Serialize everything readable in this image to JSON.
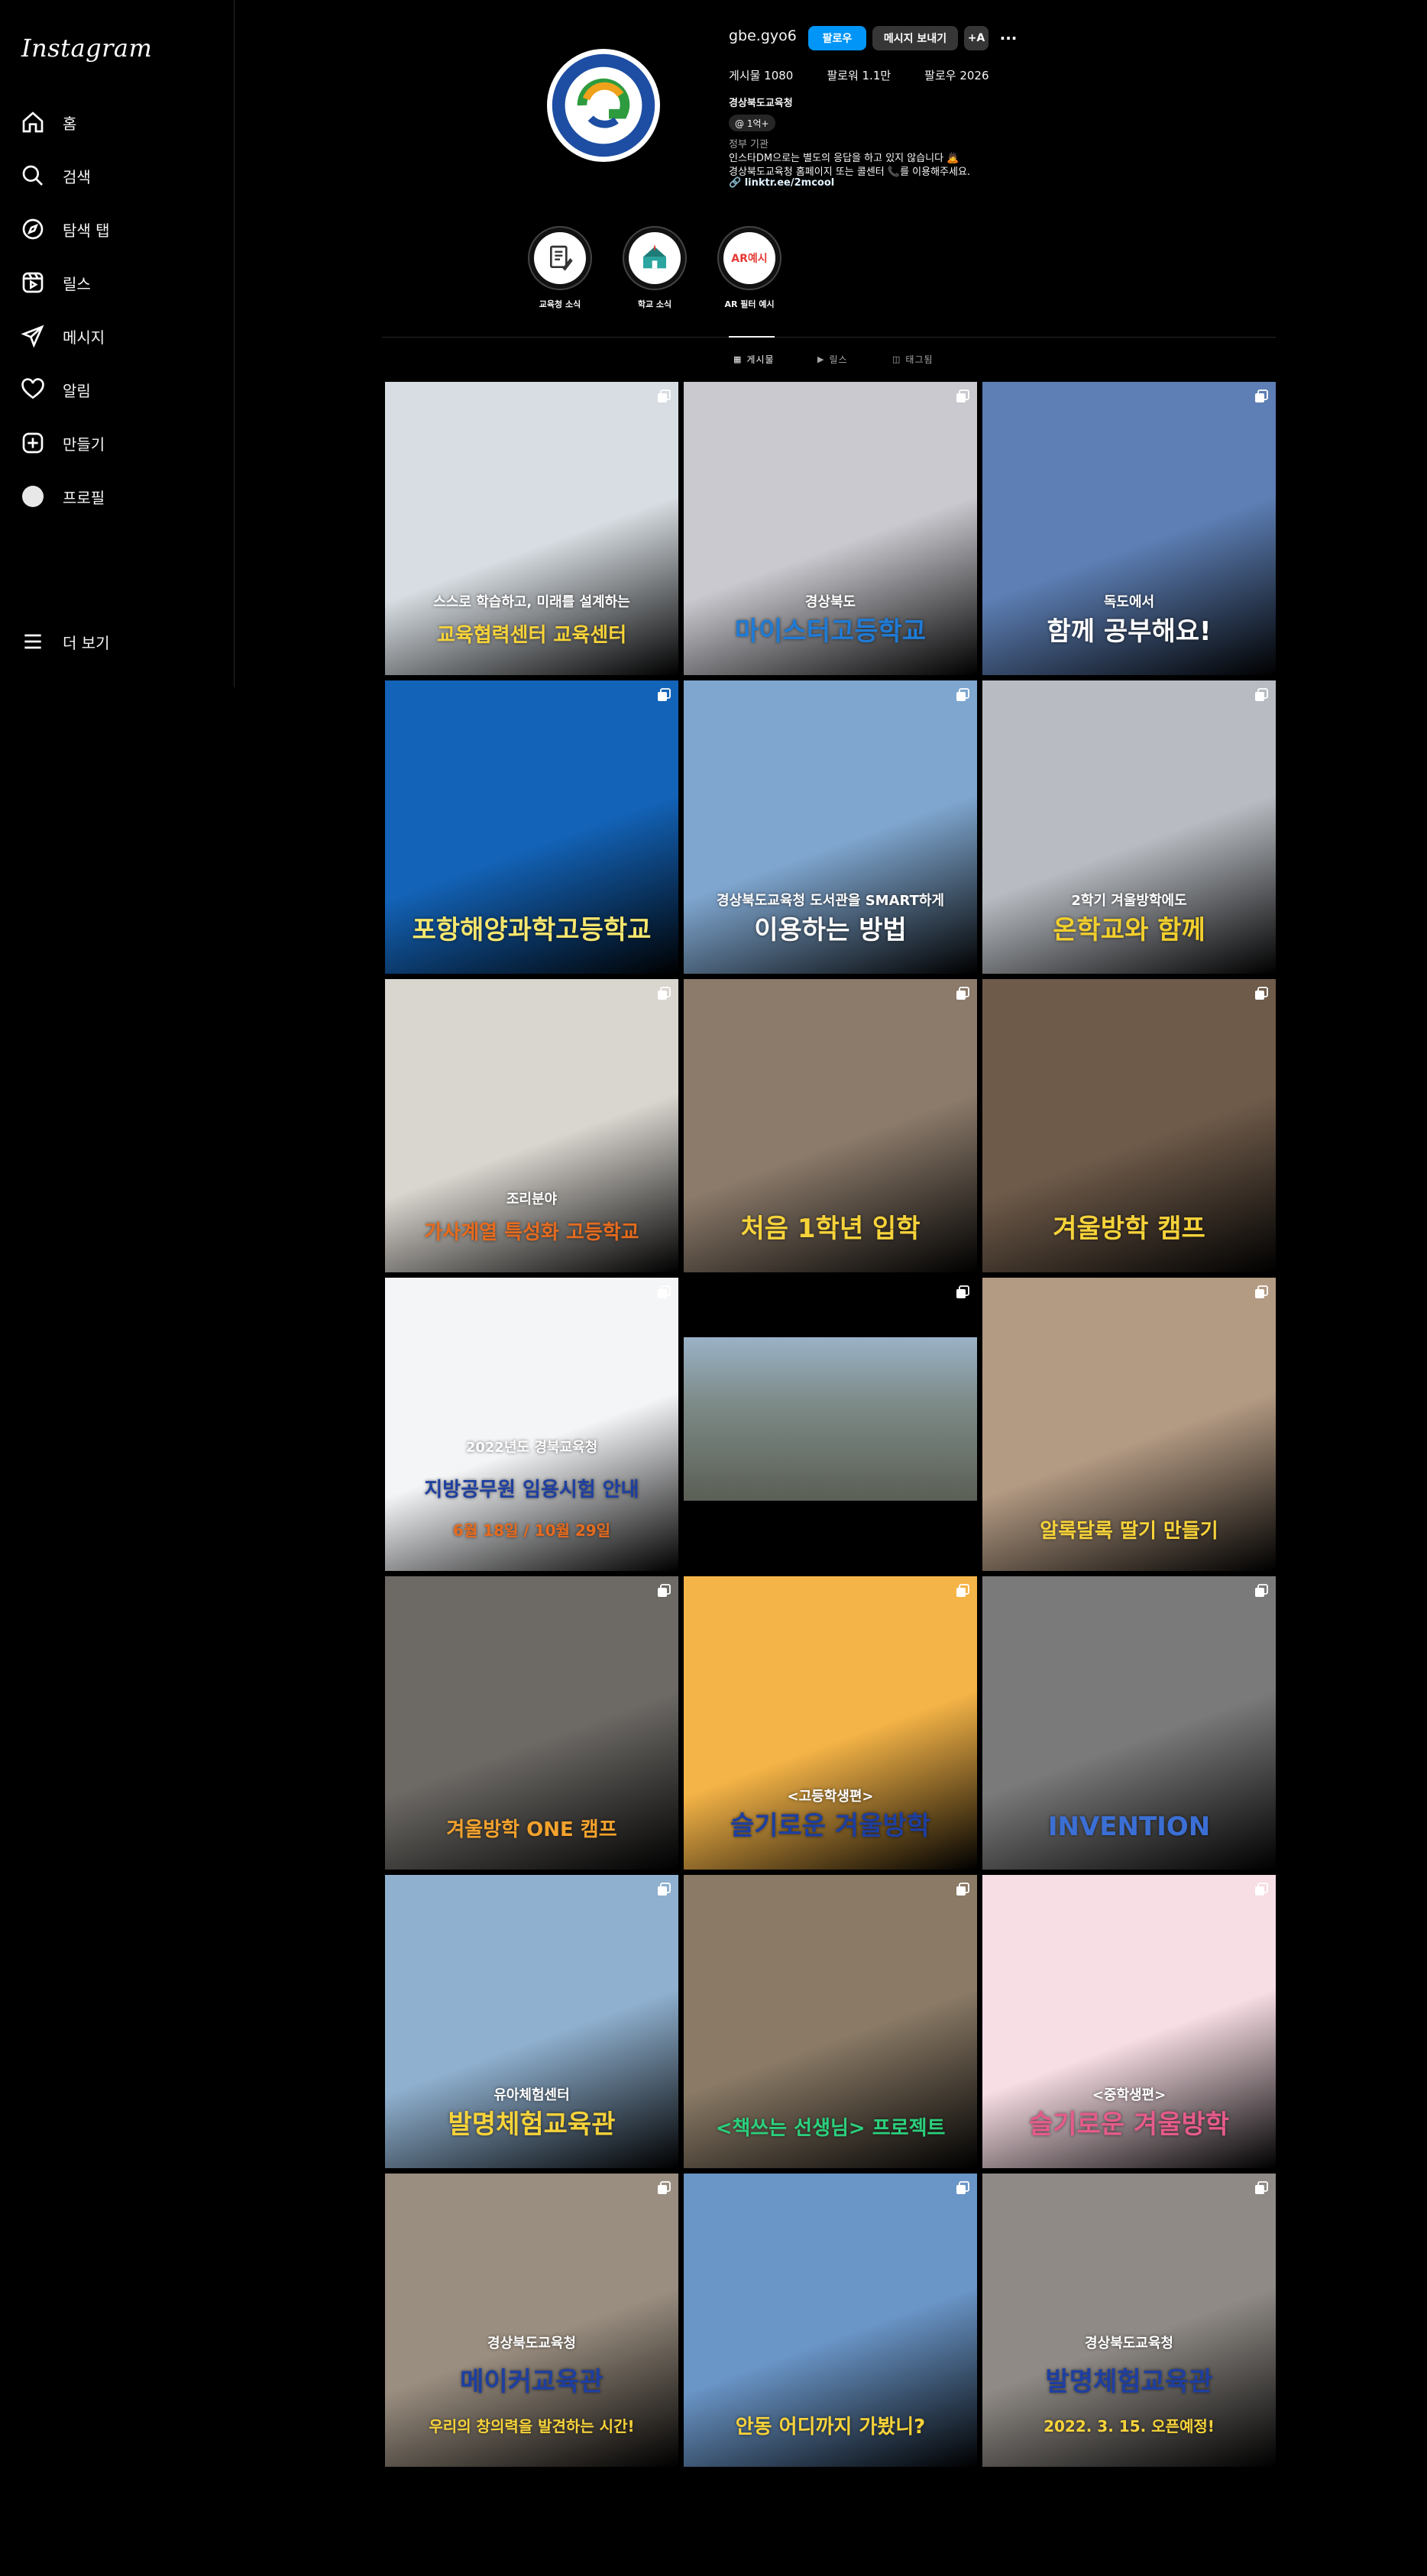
{
  "sidebar": {
    "logo": "Instagram",
    "items": [
      {
        "label": "홈",
        "icon": "home-icon"
      },
      {
        "label": "검색",
        "icon": "search-icon"
      },
      {
        "label": "탐색 탭",
        "icon": "compass-icon"
      },
      {
        "label": "릴스",
        "icon": "reels-icon"
      },
      {
        "label": "메시지",
        "icon": "send-icon"
      },
      {
        "label": "알림",
        "icon": "heart-icon"
      },
      {
        "label": "만들기",
        "icon": "plus-square-icon"
      },
      {
        "label": "프로필",
        "icon": "profile-avatar-icon"
      }
    ],
    "more_label": "더 보기"
  },
  "profile": {
    "username": "gbe.gyo6",
    "follow_label": "팔로우",
    "message_label": "메시지 보내기",
    "adduser_label": "+A",
    "more_label": "···",
    "stats": {
      "posts": "게시물 1080",
      "followers": "팔로워 1.1만",
      "following": "팔로우 2026"
    },
    "full_name": "경상북도교육청",
    "threads_badge": "@ 1억+",
    "category": "정부 기관",
    "bio_line1": "인스타DM으로는 별도의 응답을 하고 있지 않습니다 🙇",
    "bio_line2": "경상북도교육청 홈페이지 또는 콜센터 📞를 이용해주세요.",
    "link": "linktr.ee/2mcool"
  },
  "highlights": [
    {
      "label": "교육청 소식"
    },
    {
      "label": "학교 소식"
    },
    {
      "label": "AR 필터 예시",
      "inner_text": "AR예시"
    }
  ],
  "tabs": [
    {
      "label": "게시물"
    },
    {
      "label": "릴스"
    },
    {
      "label": "태그됨"
    }
  ],
  "posts": [
    {
      "caption": "교육협력센터 교육센터",
      "sub": "스스로 학습하고, 미래를 설계하는",
      "bg": "#d7dde2",
      "fg": "#f7d33a"
    },
    {
      "caption": "마이스터고등학교",
      "sub": "경상북도",
      "bg": "#c9c9cf",
      "fg": "#1f7bd6"
    },
    {
      "caption": "함께 공부해요!",
      "sub": "독도에서",
      "bg": "#5d7fb5",
      "fg": "#ffffff"
    },
    {
      "caption": "포항해양과학고등학교",
      "sub": "",
      "bg": "#1363b8",
      "fg": "#f5e66e"
    },
    {
      "caption": "이용하는 방법",
      "sub": "경상북도교육청 도서관을 SMART하게",
      "bg": "#7fa6cf",
      "fg": "#ffffff"
    },
    {
      "caption": "온학교와 함께",
      "sub": "2학기 겨울방학에도",
      "bg": "#b8bcc2",
      "fg": "#f2cf2d"
    },
    {
      "caption": "가사계열 특성화 고등학교",
      "sub": "조리분야",
      "bg": "#d9d5cf",
      "fg": "#e56b1f"
    },
    {
      "caption": "처음 1학년 입학",
      "sub": "",
      "bg": "#8c7b6b",
      "fg": "#f7d33a"
    },
    {
      "caption": "겨울방학 캠프",
      "sub": "",
      "bg": "#6f5b4a",
      "fg": "#f7d33a"
    },
    {
      "caption": "지방공무원 임용시험 안내",
      "sub": "2022년도 경북교육청",
      "date": "6월 18일 / 10월 29일",
      "bg": "#f4f5f7",
      "fg": "#1e3fa0"
    },
    {
      "caption": "",
      "sub": "",
      "bg": "#000000",
      "fg": "#ffffff"
    },
    {
      "caption": "알록달록 딸기 만들기",
      "sub": "",
      "bg": "#b39a83",
      "fg": "#f7d33a"
    },
    {
      "caption": "겨울방학 ONE 캠프",
      "sub": "",
      "bg": "#6d6a66",
      "fg": "#f2a22d"
    },
    {
      "caption": "슬기로운 겨울방학",
      "sub": "<고등학생편>",
      "bg": "#f5b447",
      "fg": "#1e3fa0"
    },
    {
      "caption": "INVENTION",
      "sub": "",
      "bg": "#7b7a7b",
      "fg": "#3b6fd4"
    },
    {
      "caption": "발명체험교육관",
      "sub": "유아체험센터",
      "bg": "#8fb0cf",
      "fg": "#f7d33a"
    },
    {
      "caption": "<책쓰는 선생님> 프로젝트",
      "sub": "",
      "bg": "#8a7a66",
      "fg": "#2bd07c"
    },
    {
      "caption": "슬기로운 겨울방학",
      "sub": "<중학생편>",
      "bg": "#f7dde4",
      "fg": "#e55b8b"
    },
    {
      "caption": "메이커교육관",
      "sub": "경상북도교육청",
      "date": "우리의 창의력을 발견하는 시간!",
      "bg": "#9a8e80",
      "fg": "#1e3fa0"
    },
    {
      "caption": "안동 어디까지 가봤니?",
      "sub": "",
      "bg": "#6a95c7",
      "fg": "#f7d33a"
    },
    {
      "caption": "발명체험교육관",
      "sub": "경상북도교육청",
      "date": "2022. 3. 15. 오픈예정!",
      "bg": "#8f8a85",
      "fg": "#1e3fa0"
    }
  ]
}
